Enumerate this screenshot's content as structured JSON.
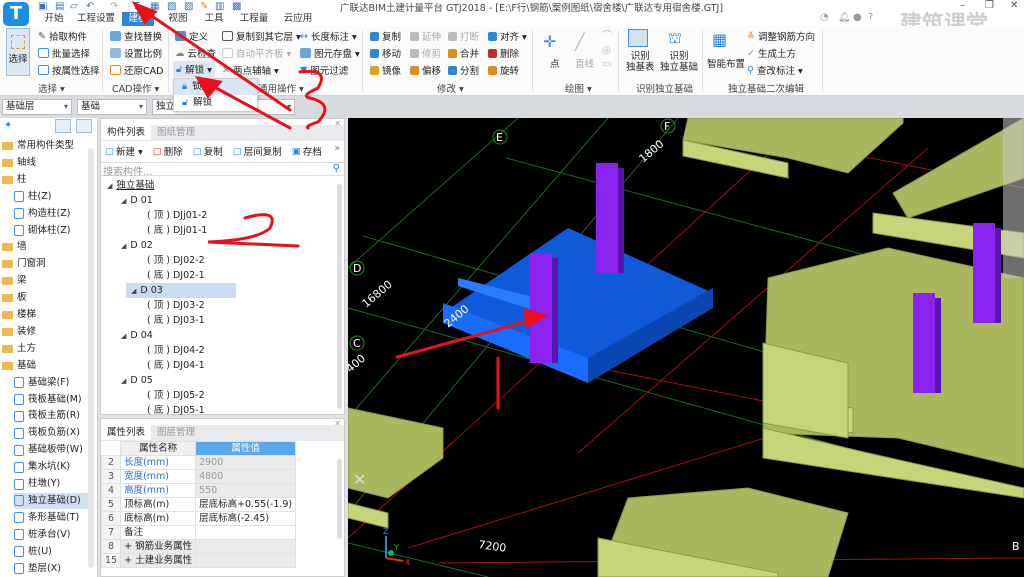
{
  "app": {
    "title": "广联达BIM土建计量平台 GTJ2018 - [E:\\F行\\钢筋\\案例图纸\\宿舍楼\\广联达专用宿舍楼.GTJ]",
    "logo": "T",
    "watermark": "建筑课堂"
  },
  "tabs": [
    "开始",
    "工程设置",
    "建模",
    "视图",
    "工具",
    "工程量",
    "云应用"
  ],
  "active_tab": "建模",
  "ribbon": {
    "select": {
      "big": "选择",
      "items": [
        "拾取构件",
        "批量选择",
        "按属性选择"
      ],
      "label": "选择 ▾"
    },
    "cad": {
      "items": [
        "查找替换",
        "设置比例",
        "还原CAD"
      ],
      "label": "CAD操作 ▾"
    },
    "general": {
      "items": [
        "定义",
        "云检查",
        "解锁 ▾",
        "复制到其它层 ▾",
        "自动平齐板 ▾",
        "两点辅轴 ▾",
        "长度标注 ▾",
        "图元存盘 ▾",
        "图元过滤"
      ],
      "label": "通用操作 ▾"
    },
    "modify": {
      "items": [
        "复制",
        "延伸",
        "打断",
        "对齐 ▾",
        "移动",
        "修剪",
        "合并",
        "删除",
        "镜像",
        "偏移",
        "分割",
        "旋转"
      ],
      "label": "修改 ▾"
    },
    "draw": {
      "items": [
        "点",
        "直线"
      ],
      "label": "绘图 ▾"
    },
    "recognize": {
      "items": [
        "识别\n独基表",
        "识别\n独立基础"
      ],
      "label": "识别独立基础"
    },
    "secondary": {
      "big": "智能布置",
      "items": [
        "调整钢筋方向",
        "生成土方",
        "查改标注 ▾"
      ],
      "label": "独立基础二次编辑"
    }
  },
  "lock_menu": [
    "锁定",
    "解锁"
  ],
  "toolrow": {
    "floor": "基础层",
    "category": "基础",
    "type": "独立基础"
  },
  "sidebar": {
    "items": [
      {
        "label": "常用构件类型",
        "level": 0
      },
      {
        "label": "轴线",
        "level": 0
      },
      {
        "label": "柱",
        "level": 0,
        "open": true
      },
      {
        "label": "柱(Z)",
        "level": 1
      },
      {
        "label": "构造柱(Z)",
        "level": 1
      },
      {
        "label": "砌体柱(Z)",
        "level": 1
      },
      {
        "label": "墙",
        "level": 0
      },
      {
        "label": "门窗洞",
        "level": 0
      },
      {
        "label": "梁",
        "level": 0
      },
      {
        "label": "板",
        "level": 0
      },
      {
        "label": "楼梯",
        "level": 0
      },
      {
        "label": "装修",
        "level": 0
      },
      {
        "label": "土方",
        "level": 0
      },
      {
        "label": "基础",
        "level": 0,
        "open": true
      },
      {
        "label": "基础梁(F)",
        "level": 1
      },
      {
        "label": "筏板基础(M)",
        "level": 1
      },
      {
        "label": "筏板主筋(R)",
        "level": 1
      },
      {
        "label": "筏板负筋(X)",
        "level": 1
      },
      {
        "label": "基础板带(W)",
        "level": 1
      },
      {
        "label": "集水坑(K)",
        "level": 1
      },
      {
        "label": "柱墩(Y)",
        "level": 1
      },
      {
        "label": "独立基础(D)",
        "level": 1,
        "selected": true
      },
      {
        "label": "条形基础(T)",
        "level": 1
      },
      {
        "label": "桩承台(V)",
        "level": 1
      },
      {
        "label": "桩(U)",
        "level": 1
      },
      {
        "label": "垫层(X)",
        "level": 1
      }
    ]
  },
  "complist": {
    "tabs": [
      "构件列表",
      "图纸管理"
    ],
    "toolbar": [
      "新建 ▾",
      "删除",
      "复制",
      "层间复制",
      "存档"
    ],
    "search_placeholder": "搜索构件...",
    "tree": [
      {
        "t": "独立基础",
        "l": 0
      },
      {
        "t": "D 01",
        "l": 1
      },
      {
        "t": "( 顶 ) DJj01-2",
        "l": 2
      },
      {
        "t": "( 底 ) DJj01-1",
        "l": 2
      },
      {
        "t": "D 02",
        "l": 1
      },
      {
        "t": "( 顶 ) DJ02-2",
        "l": 2
      },
      {
        "t": "( 底 ) DJ02-1",
        "l": 2
      },
      {
        "t": "D 03",
        "l": 1,
        "sel": true
      },
      {
        "t": "( 顶 ) DJ03-2",
        "l": 2
      },
      {
        "t": "( 底 ) DJ03-1",
        "l": 2
      },
      {
        "t": "D 04",
        "l": 1
      },
      {
        "t": "( 顶 ) DJ04-2",
        "l": 2
      },
      {
        "t": "( 底 ) DJ04-1",
        "l": 2
      },
      {
        "t": "D 05",
        "l": 1
      },
      {
        "t": "( 顶 ) DJ05-2",
        "l": 2
      },
      {
        "t": "( 底 ) DJ05-1",
        "l": 2
      }
    ]
  },
  "props": {
    "tabs": [
      "属性列表",
      "图层管理"
    ],
    "headers": [
      "属性名称",
      "属性值"
    ],
    "rows": [
      [
        "2",
        "长度(mm)",
        "2900"
      ],
      [
        "3",
        "宽度(mm)",
        "4800"
      ],
      [
        "4",
        "高度(mm)",
        "550"
      ],
      [
        "5",
        "顶标高(m)",
        "层底标高+0.55(-1.9)"
      ],
      [
        "6",
        "底标高(m)",
        "层底标高(-2.45)"
      ],
      [
        "7",
        "备注",
        ""
      ],
      [
        "8",
        "+ 钢筋业务属性",
        ""
      ],
      [
        "15",
        "+ 土建业务属性",
        ""
      ]
    ]
  },
  "viewport": {
    "axes": [
      "E",
      "F",
      "D",
      "C",
      "B"
    ],
    "dims": [
      "1800",
      "16800",
      "2400",
      "400",
      "7200"
    ],
    "axis_letters": [
      "Z",
      "Y",
      "X"
    ]
  },
  "annotations": [
    "3",
    "2"
  ],
  "colors": {
    "accent": "#2b86d9",
    "selected_footing": "#1565e8",
    "footing": "#b4c468",
    "column": "#8a22f0",
    "annotation": "#e8101a"
  }
}
